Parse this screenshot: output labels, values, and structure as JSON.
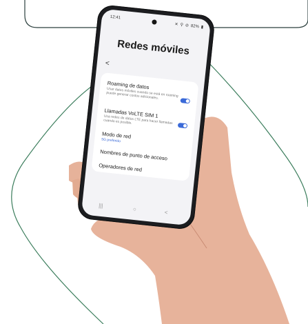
{
  "status_bar": {
    "time": "12:41",
    "icons": [
      "mute-icon",
      "location-icon",
      "dnd-icon"
    ],
    "battery": "82%"
  },
  "screen": {
    "title": "Redes móviles",
    "back_glyph": "<"
  },
  "settings": [
    {
      "title": "Roaming de datos",
      "subtitle": "Usar datos móviles cuando se está en roaming puede generar costos adicionales.",
      "toggle": true
    },
    {
      "title": "Llamadas VoLTE SIM 1",
      "subtitle": "Usa redes de datos LTE para hacer llamadas cuando es posible.",
      "toggle": true
    },
    {
      "title": "Modo de red",
      "subtitle": "5G preferido",
      "toggle": false
    },
    {
      "title": "Nombres de punto de acceso",
      "subtitle": "",
      "toggle": false
    },
    {
      "title": "Operadores de red",
      "subtitle": "",
      "toggle": false
    }
  ],
  "nav_bar": {
    "recents": "|||",
    "home": "○",
    "back": "<"
  },
  "colors": {
    "accent": "#3b6ad8",
    "outline": "#2a3e3c",
    "frame": "#1c1d20",
    "screen": "#f3f3f6"
  }
}
